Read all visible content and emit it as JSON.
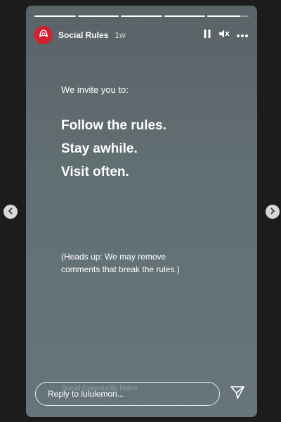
{
  "story": {
    "progress": [
      1,
      1,
      1,
      1,
      0.8
    ],
    "account": {
      "name": "Social Rules",
      "posted": "1w",
      "avatar_color": "#d31f2f"
    },
    "controls": [
      "pause-icon",
      "mute-icon",
      "more-icon"
    ],
    "intro": "We invite you to:",
    "rules": [
      "Follow the rules.",
      "Stay awhile.",
      "Visit often."
    ],
    "note_line1": "(Heads up: We may remove",
    "note_line2": "comments that break the rules.)",
    "ghost_caption": "Social Community Rules",
    "reply_placeholder": "Reply to lululemon..."
  },
  "colors": {
    "background": "#1c1c1c",
    "story_gray": "#627074",
    "accent": "#d31f2f"
  },
  "nav": {
    "prev": "chevron-left-icon",
    "next": "chevron-right-icon"
  }
}
